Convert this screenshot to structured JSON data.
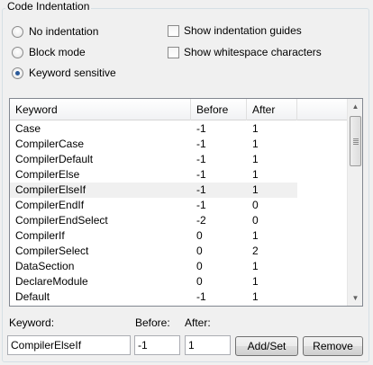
{
  "group_title": "Code Indentation",
  "modes": [
    {
      "label": "No indentation",
      "checked": false
    },
    {
      "label": "Block mode",
      "checked": false
    },
    {
      "label": "Keyword sensitive",
      "checked": true
    }
  ],
  "options": [
    {
      "label": "Show indentation guides",
      "checked": false
    },
    {
      "label": "Show whitespace characters",
      "checked": false
    }
  ],
  "table": {
    "headers": [
      "Keyword",
      "Before",
      "After"
    ],
    "selected_index": 4,
    "rows": [
      {
        "keyword": "Case",
        "before": "-1",
        "after": "1"
      },
      {
        "keyword": "CompilerCase",
        "before": "-1",
        "after": "1"
      },
      {
        "keyword": "CompilerDefault",
        "before": "-1",
        "after": "1"
      },
      {
        "keyword": "CompilerElse",
        "before": "-1",
        "after": "1"
      },
      {
        "keyword": "CompilerElseIf",
        "before": "-1",
        "after": "1"
      },
      {
        "keyword": "CompilerEndIf",
        "before": "-1",
        "after": "0"
      },
      {
        "keyword": "CompilerEndSelect",
        "before": "-2",
        "after": "0"
      },
      {
        "keyword": "CompilerIf",
        "before": "0",
        "after": "1"
      },
      {
        "keyword": "CompilerSelect",
        "before": "0",
        "after": "2"
      },
      {
        "keyword": "DataSection",
        "before": "0",
        "after": "1"
      },
      {
        "keyword": "DeclareModule",
        "before": "0",
        "after": "1"
      },
      {
        "keyword": "Default",
        "before": "-1",
        "after": "1"
      }
    ]
  },
  "editor": {
    "keyword_label": "Keyword:",
    "before_label": "Before:",
    "after_label": "After:",
    "keyword_value": "CompilerElseIf",
    "before_value": "-1",
    "after_value": "1",
    "add_button": "Add/Set",
    "remove_button": "Remove"
  }
}
